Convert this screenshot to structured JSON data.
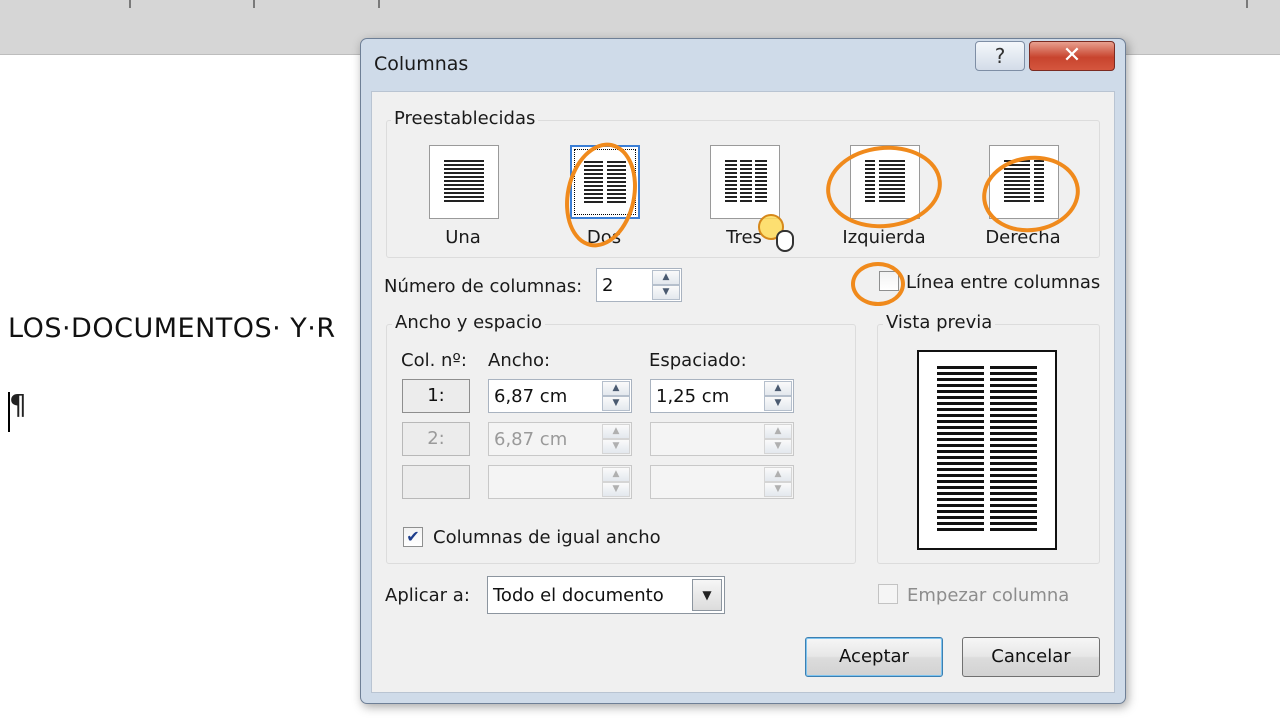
{
  "document": {
    "text_line": "LOS·DOCUMENTOS· Y·R",
    "pilcrow": "¶"
  },
  "dialog": {
    "title": "Columnas",
    "help_icon": "?",
    "close_icon": "✕"
  },
  "presets": {
    "group_label": "Preestablecidas",
    "items": [
      {
        "label": "Una",
        "selected": false
      },
      {
        "label": "Dos",
        "selected": true
      },
      {
        "label": "Tres",
        "selected": false
      },
      {
        "label": "Izquierda",
        "selected": false
      },
      {
        "label": "Derecha",
        "selected": false
      }
    ]
  },
  "num_columns": {
    "label": "Número de columnas:",
    "value": "2"
  },
  "line_between": {
    "label": "Línea entre columnas",
    "checked": false
  },
  "width_spacing": {
    "group_label": "Ancho y espacio",
    "col_header": "Col. nº:",
    "width_header": "Ancho:",
    "spacing_header": "Espaciado:",
    "rows": [
      {
        "col": "1:",
        "width": "6,87 cm",
        "spacing": "1,25 cm",
        "enabled": true
      },
      {
        "col": "2:",
        "width": "6,87 cm",
        "spacing": "",
        "enabled": false
      },
      {
        "col": "",
        "width": "",
        "spacing": "",
        "enabled": false
      }
    ],
    "equal_width": {
      "label": "Columnas de igual ancho",
      "checked": true
    }
  },
  "preview": {
    "label": "Vista previa"
  },
  "apply_to": {
    "label": "Aplicar a:",
    "value": "Todo el documento"
  },
  "start_column": {
    "label": "Empezar columna",
    "checked": false,
    "enabled": false
  },
  "buttons": {
    "ok": "Aceptar",
    "cancel": "Cancelar"
  },
  "colors": {
    "annotation": "#f08a1c",
    "dialog_frame": "#cfdbe9",
    "close_button": "#c8442e"
  }
}
